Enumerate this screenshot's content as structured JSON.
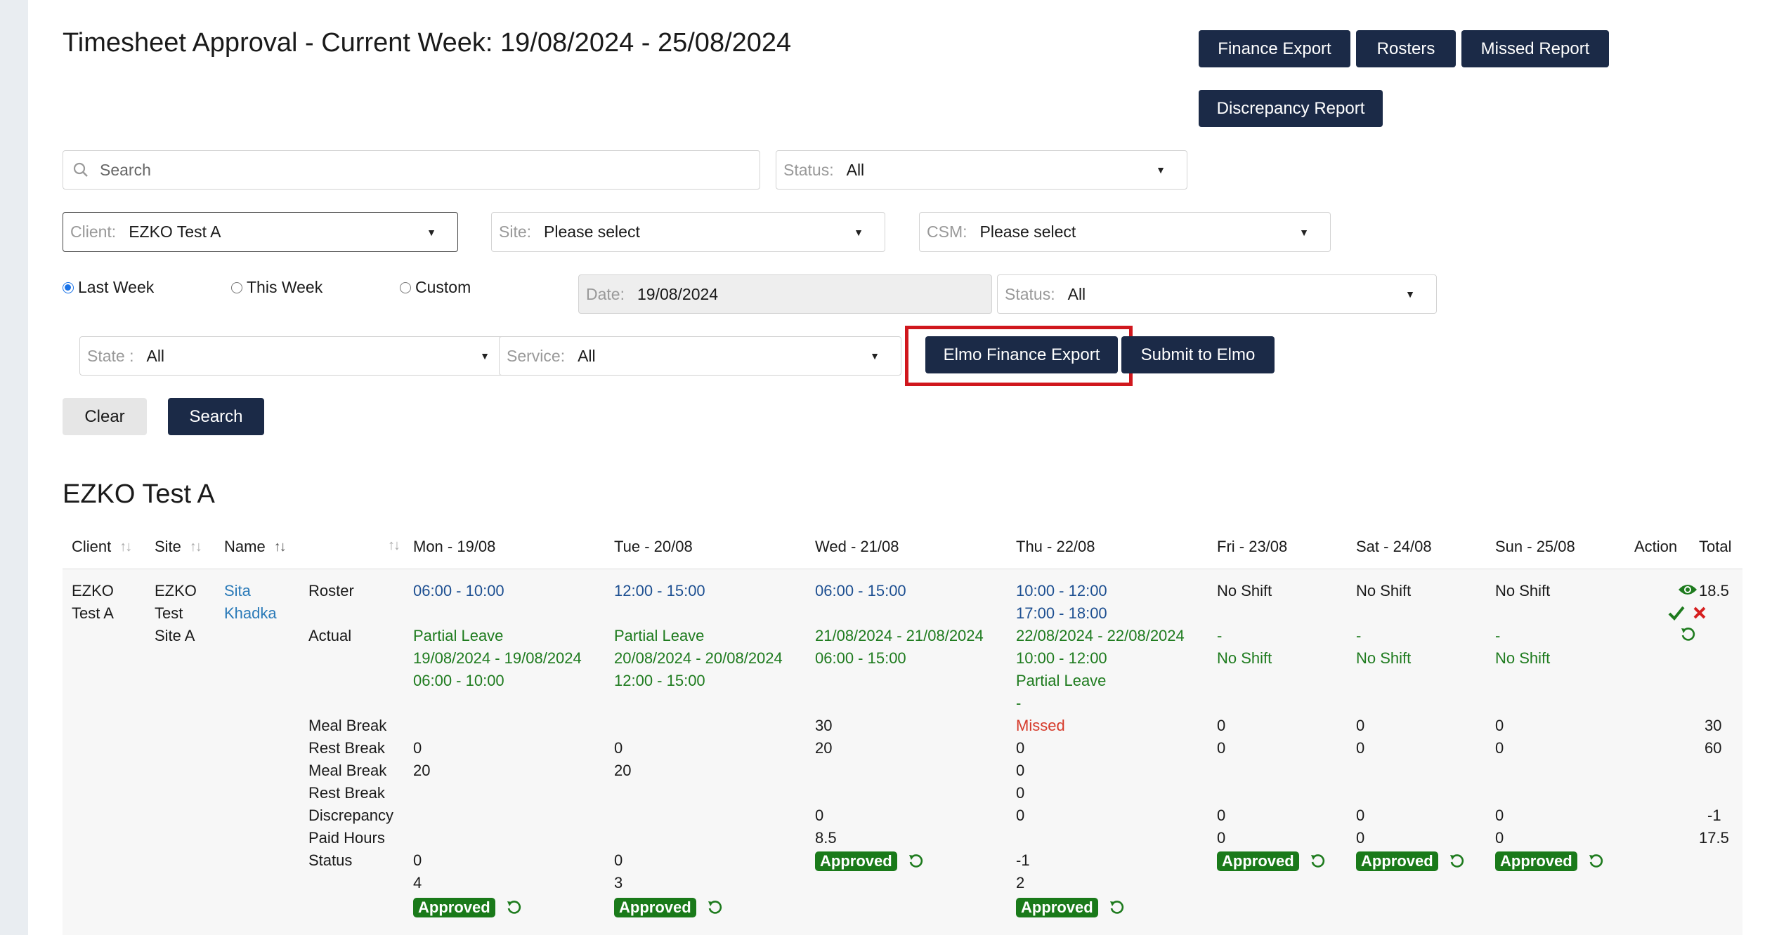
{
  "header": {
    "title": "Timesheet Approval - Current Week: 19/08/2024 - 25/08/2024",
    "finance_export": "Finance Export",
    "rosters": "Rosters",
    "missed_report": "Missed Report",
    "discrepancy_report": "Discrepancy Report"
  },
  "filters": {
    "search_placeholder": "Search",
    "status1": {
      "label": "Status:",
      "value": "All"
    },
    "client": {
      "label": "Client:",
      "value": "EZKO Test A"
    },
    "site": {
      "label": "Site:",
      "value": "Please select"
    },
    "csm": {
      "label": "CSM:",
      "value": "Please select"
    },
    "radios": [
      {
        "label": "Last Week",
        "checked": true
      },
      {
        "label": "This Week",
        "checked": false
      },
      {
        "label": "Custom",
        "checked": false
      }
    ],
    "date": {
      "label": "Date:",
      "value": "19/08/2024"
    },
    "status2": {
      "label": "Status:",
      "value": "All"
    },
    "state": {
      "label": "State :",
      "value": "All"
    },
    "service": {
      "label": "Service:",
      "value": "All"
    },
    "elmo_finance_export": "Elmo Finance Export",
    "submit_to_elmo": "Submit to Elmo",
    "clear": "Clear",
    "search": "Search"
  },
  "section_title": "EZKO Test A",
  "table": {
    "headers": {
      "client": "Client",
      "site": "Site",
      "name": "Name",
      "mon": "Mon - 19/08",
      "tue": "Tue - 20/08",
      "wed": "Wed - 21/08",
      "thu": "Thu - 22/08",
      "fri": "Fri - 23/08",
      "sat": "Sat - 24/08",
      "sun": "Sun - 25/08",
      "action": "Action",
      "total": "Total"
    },
    "row": {
      "client": [
        "EZKO",
        "Test A"
      ],
      "site": [
        "EZKO",
        "Test",
        "Site A"
      ],
      "name": [
        "Sita",
        "Khadka"
      ],
      "labels": [
        "Roster",
        "Actual",
        "Meal Break",
        "Rest Break",
        "Meal Break",
        "Rest Break",
        "Discrepancy",
        "Paid Hours",
        "Status"
      ],
      "mon": {
        "roster": "06:00 - 10:00",
        "actual": [
          "Partial Leave",
          "19/08/2024 - 19/08/2024",
          "06:00 - 10:00"
        ],
        "rest_break": "0",
        "meal_break2": "20",
        "status_lines": [
          "0",
          "4"
        ],
        "badge": "Approved"
      },
      "tue": {
        "roster": "12:00 - 15:00",
        "actual": [
          "Partial Leave",
          "20/08/2024 - 20/08/2024",
          "12:00 - 15:00"
        ],
        "rest_break": "0",
        "meal_break2": "20",
        "status_lines": [
          "0",
          "3"
        ],
        "badge": "Approved"
      },
      "wed": {
        "roster": "06:00 - 15:00",
        "actual": [
          "21/08/2024 - 21/08/2024",
          "06:00 - 15:00"
        ],
        "meal_break": "30",
        "rest_break": "20",
        "discrepancy": "0",
        "paid_hours": "8.5",
        "badge": "Approved"
      },
      "thu": {
        "roster": [
          "10:00 - 12:00",
          "17:00 - 18:00"
        ],
        "actual": [
          "22/08/2024 - 22/08/2024",
          "10:00 - 12:00",
          "Partial Leave",
          "-"
        ],
        "meal_break": "Missed",
        "rest_break": "0",
        "meal_break2": "0",
        "rest_break2": "0",
        "discrepancy": "0",
        "status_lines": [
          "-1",
          "2"
        ],
        "badge": "Approved"
      },
      "fri": {
        "roster": "No Shift",
        "actual": [
          "-",
          "No Shift"
        ],
        "meal_break": "0",
        "rest_break": "0",
        "discrepancy": "0",
        "paid_hours": "0",
        "badge": "Approved"
      },
      "sat": {
        "roster": "No Shift",
        "actual": [
          "-",
          "No Shift"
        ],
        "meal_break": "0",
        "rest_break": "0",
        "discrepancy": "0",
        "paid_hours": "0",
        "badge": "Approved"
      },
      "sun": {
        "roster": "No Shift",
        "actual": [
          "-",
          "No Shift"
        ],
        "meal_break": "0",
        "rest_break": "0",
        "discrepancy": "0",
        "paid_hours": "0",
        "badge": "Approved"
      },
      "total": {
        "roster": "18.5",
        "meal_break": "30",
        "rest_break": "60",
        "discrepancy": "-1",
        "paid_hours": "17.5"
      }
    }
  }
}
